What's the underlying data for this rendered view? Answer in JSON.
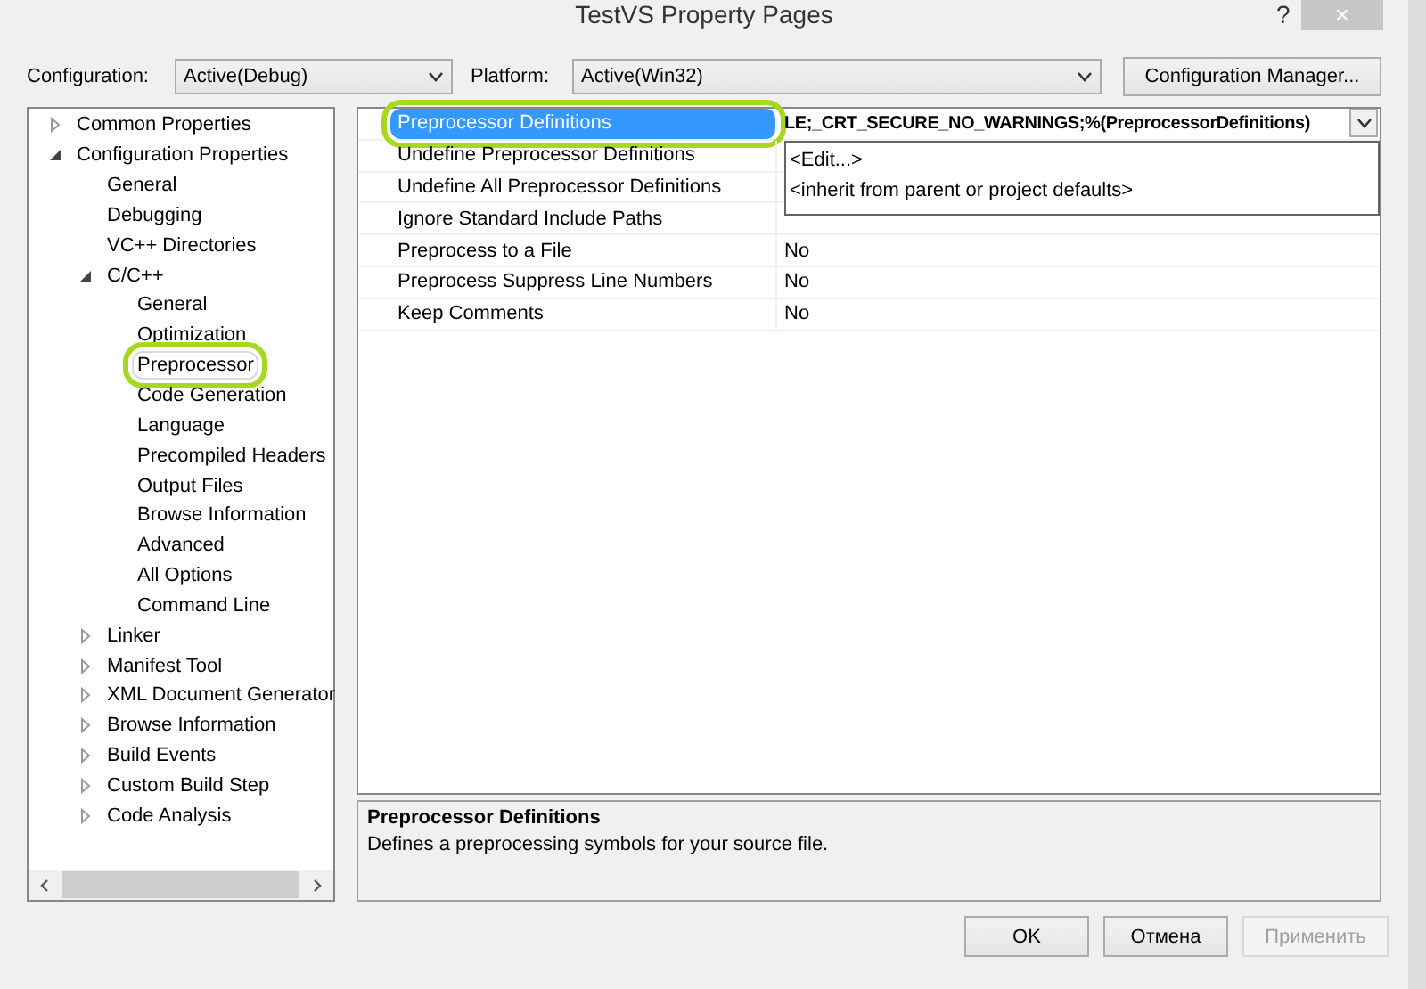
{
  "window": {
    "title": "TestVS Property Pages",
    "help_button": "?",
    "close_button": "×"
  },
  "toolbar": {
    "configuration": {
      "label": "Configuration:",
      "value": "Active(Debug)"
    },
    "platform": {
      "label": "Platform:",
      "value": "Active(Win32)"
    },
    "manager_button": "Configuration Manager..."
  },
  "tree": [
    {
      "label": "Common Properties",
      "expanded": false,
      "selected": false,
      "highlighted": false
    },
    {
      "label": "Configuration Properties",
      "expanded": true,
      "selected": false,
      "highlighted": false,
      "children": [
        {
          "label": "General",
          "selected": false,
          "highlighted": false
        },
        {
          "label": "Debugging",
          "selected": false,
          "highlighted": false
        },
        {
          "label": "VC++ Directories",
          "selected": false,
          "highlighted": false
        },
        {
          "label": "C/C++",
          "expanded": true,
          "selected": false,
          "highlighted": false,
          "children": [
            {
              "label": "General",
              "selected": false,
              "highlighted": false
            },
            {
              "label": "Optimization",
              "selected": false,
              "highlighted": false
            },
            {
              "label": "Preprocessor",
              "selected": true,
              "highlighted": true
            },
            {
              "label": "Code Generation",
              "selected": false,
              "highlighted": false
            },
            {
              "label": "Language",
              "selected": false,
              "highlighted": false
            },
            {
              "label": "Precompiled Headers",
              "selected": false,
              "highlighted": false
            },
            {
              "label": "Output Files",
              "selected": false,
              "highlighted": false
            },
            {
              "label": "Browse Information",
              "selected": false,
              "highlighted": false
            },
            {
              "label": "Advanced",
              "selected": false,
              "highlighted": false
            },
            {
              "label": "All Options",
              "selected": false,
              "highlighted": false
            },
            {
              "label": "Command Line",
              "selected": false,
              "highlighted": false
            }
          ]
        },
        {
          "label": "Linker",
          "expanded": false,
          "selected": false,
          "highlighted": false
        },
        {
          "label": "Manifest Tool",
          "expanded": false,
          "selected": false,
          "highlighted": false
        },
        {
          "label": "XML Document Generator",
          "expanded": false,
          "selected": false,
          "highlighted": false
        },
        {
          "label": "Browse Information",
          "expanded": false,
          "selected": false,
          "highlighted": false
        },
        {
          "label": "Build Events",
          "expanded": false,
          "selected": false,
          "highlighted": false
        },
        {
          "label": "Custom Build Step",
          "expanded": false,
          "selected": false,
          "highlighted": false
        },
        {
          "label": "Code Analysis",
          "expanded": false,
          "selected": false,
          "highlighted": false
        }
      ]
    }
  ],
  "properties": [
    {
      "name": "Preprocessor Definitions",
      "value": "LE;_CRT_SECURE_NO_WARNINGS;%(PreprocessorDefinitions)",
      "selected": true,
      "highlighted": true
    },
    {
      "name": "Undefine Preprocessor Definitions",
      "selected": false,
      "highlighted": false
    },
    {
      "name": "Undefine All Preprocessor Definitions",
      "selected": false,
      "highlighted": false
    },
    {
      "name": "Ignore Standard Include Paths",
      "selected": false,
      "highlighted": false
    },
    {
      "name": "Preprocess to a File",
      "value": "No",
      "selected": false,
      "highlighted": false
    },
    {
      "name": "Preprocess Suppress Line Numbers",
      "value": "No",
      "selected": false,
      "highlighted": false
    },
    {
      "name": "Keep Comments",
      "value": "No",
      "selected": false,
      "highlighted": false
    }
  ],
  "dropdown": {
    "options": [
      "<Edit...>",
      "<inherit from parent or project defaults>"
    ]
  },
  "description": {
    "title": "Preprocessor Definitions",
    "text": "Defines a preprocessing symbols for your source file."
  },
  "buttons": [
    {
      "label": "OK",
      "disabled": false
    },
    {
      "label": "Отмена",
      "disabled": false
    },
    {
      "label": "Применить",
      "disabled": true
    }
  ]
}
